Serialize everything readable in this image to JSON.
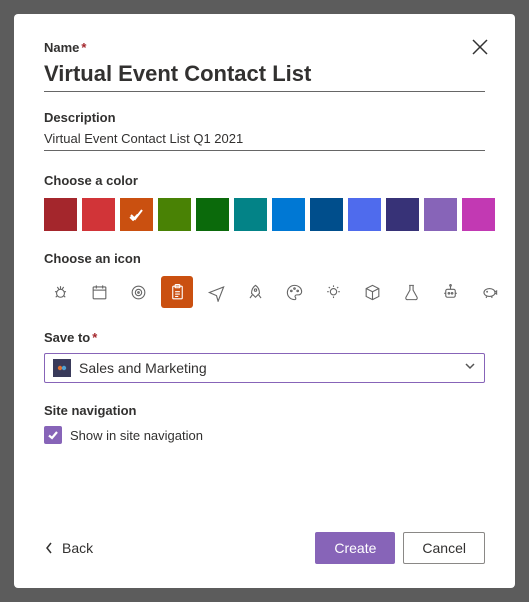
{
  "labels": {
    "name": "Name",
    "description": "Description",
    "choose_color": "Choose a color",
    "choose_icon": "Choose an icon",
    "save_to": "Save to",
    "site_nav": "Site navigation"
  },
  "values": {
    "name": "Virtual Event Contact List",
    "description": "Virtual Event Contact List Q1 2021",
    "save_to_site": "Sales and Marketing",
    "show_in_nav_label": "Show in site navigation",
    "show_in_nav_checked": true
  },
  "colors": [
    {
      "hex": "#a4262c",
      "selected": false
    },
    {
      "hex": "#d13438",
      "selected": false
    },
    {
      "hex": "#ca5010",
      "selected": true
    },
    {
      "hex": "#498205",
      "selected": false
    },
    {
      "hex": "#0b6a0b",
      "selected": false
    },
    {
      "hex": "#038387",
      "selected": false
    },
    {
      "hex": "#0078d4",
      "selected": false
    },
    {
      "hex": "#004e8c",
      "selected": false
    },
    {
      "hex": "#4f6bed",
      "selected": false
    },
    {
      "hex": "#373277",
      "selected": false
    },
    {
      "hex": "#8764b8",
      "selected": false
    },
    {
      "hex": "#c239b3",
      "selected": false
    }
  ],
  "icons": [
    {
      "name": "bug-icon",
      "selected": false
    },
    {
      "name": "calendar-icon",
      "selected": false
    },
    {
      "name": "target-icon",
      "selected": false
    },
    {
      "name": "clipboard-icon",
      "selected": true
    },
    {
      "name": "airplane-icon",
      "selected": false
    },
    {
      "name": "rocket-icon",
      "selected": false
    },
    {
      "name": "palette-icon",
      "selected": false
    },
    {
      "name": "lightbulb-icon",
      "selected": false
    },
    {
      "name": "cube-icon",
      "selected": false
    },
    {
      "name": "flask-icon",
      "selected": false
    },
    {
      "name": "robot-icon",
      "selected": false
    },
    {
      "name": "piggybank-icon",
      "selected": false
    }
  ],
  "buttons": {
    "back": "Back",
    "create": "Create",
    "cancel": "Cancel"
  }
}
